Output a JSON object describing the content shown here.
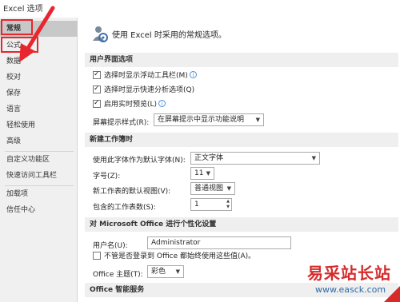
{
  "window": {
    "title": "Excel 选项"
  },
  "sidebar": {
    "items": [
      {
        "label": "常规",
        "active": true
      },
      {
        "label": "公式",
        "active": false
      },
      {
        "label": "数据",
        "active": false
      },
      {
        "label": "校对",
        "active": false
      },
      {
        "label": "保存",
        "active": false
      },
      {
        "label": "语言",
        "active": false
      },
      {
        "label": "轻松使用",
        "active": false
      },
      {
        "label": "高级",
        "active": false
      },
      {
        "label": "自定义功能区",
        "active": false
      },
      {
        "label": "快速访问工具栏",
        "active": false
      },
      {
        "label": "加载项",
        "active": false
      },
      {
        "label": "信任中心",
        "active": false
      }
    ]
  },
  "header": {
    "text": "使用 Excel 时采用的常规选项。",
    "icon": "general-options-icon"
  },
  "ui_options": {
    "title": "用户界面选项",
    "mini_toolbar": {
      "label": "选择时显示浮动工具栏(M)",
      "checked": true
    },
    "quick_analysis": {
      "label": "选择时显示快速分析选项(Q)",
      "checked": true
    },
    "live_preview": {
      "label": "启用实时预览(L)",
      "checked": true
    },
    "screentip_label": "屏幕提示样式(R):",
    "screentip_value": "在屏幕提示中显示功能说明"
  },
  "new_workbook": {
    "title": "新建工作簿时",
    "font_label": "使用此字体作为默认字体(N):",
    "font_value": "正文字体",
    "size_label": "字号(Z):",
    "size_value": "11",
    "view_label": "新工作表的默认视图(V):",
    "view_value": "普通视图",
    "sheets_label": "包含的工作表数(S):",
    "sheets_value": "1"
  },
  "personalize": {
    "title": "对 Microsoft Office 进行个性化设置",
    "username_label": "用户名(U):",
    "username_value": "Administrator",
    "always_use_label": "不管是否登录到 Office 都始终使用这些值(A)。",
    "always_use_checked": false,
    "theme_label": "Office 主题(T):",
    "theme_value": "彩色"
  },
  "intelligent": {
    "title": "Office 智能服务"
  },
  "annotations": {
    "highlight_color": "#e8262d"
  },
  "watermark": {
    "text": "易采站长站",
    "url": "www.easck.com"
  }
}
